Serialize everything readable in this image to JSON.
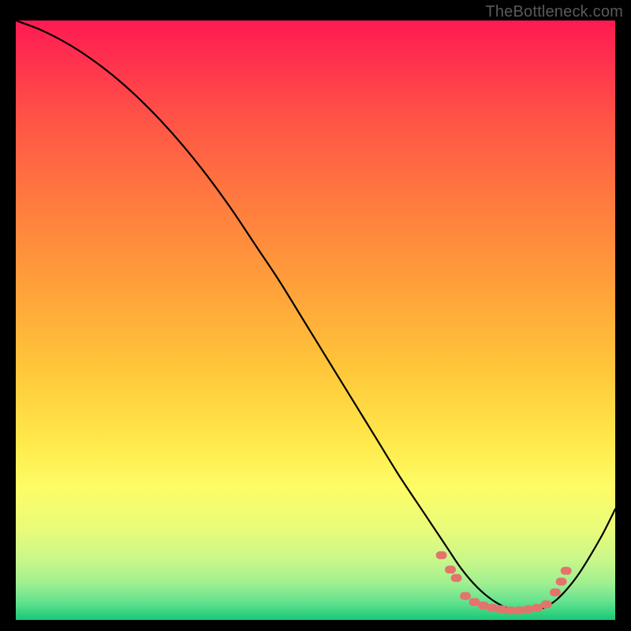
{
  "site": {
    "watermark": "TheBottleneck.com"
  },
  "chart_data": {
    "type": "line",
    "title": "",
    "xlabel": "",
    "ylabel": "",
    "xlim": [
      0,
      100
    ],
    "ylim": [
      0,
      100
    ],
    "background_gradient": {
      "stops": [
        {
          "offset": 0.0,
          "color": "#ff1a52"
        },
        {
          "offset": 0.05,
          "color": "#ff2b4f"
        },
        {
          "offset": 0.15,
          "color": "#ff4f47"
        },
        {
          "offset": 0.3,
          "color": "#ff7a3f"
        },
        {
          "offset": 0.45,
          "color": "#ffa23a"
        },
        {
          "offset": 0.58,
          "color": "#ffc63a"
        },
        {
          "offset": 0.7,
          "color": "#ffe84a"
        },
        {
          "offset": 0.78,
          "color": "#fdfd66"
        },
        {
          "offset": 0.85,
          "color": "#e8fb7a"
        },
        {
          "offset": 0.9,
          "color": "#c9f78a"
        },
        {
          "offset": 0.94,
          "color": "#9eef90"
        },
        {
          "offset": 0.97,
          "color": "#63e28f"
        },
        {
          "offset": 1.0,
          "color": "#17c877"
        }
      ]
    },
    "series": [
      {
        "name": "bottleneck-curve",
        "x": [
          0,
          4,
          8,
          12,
          16,
          20,
          24,
          28,
          32,
          36,
          40,
          44,
          48,
          52,
          56,
          60,
          64,
          68,
          70,
          72,
          74,
          76,
          78,
          80,
          82,
          84,
          86,
          88,
          90,
          92,
          94,
          96,
          98,
          100
        ],
        "y": [
          100,
          98.5,
          96.5,
          94,
          91,
          87.5,
          83.5,
          79,
          74,
          68.5,
          62.5,
          56.5,
          50,
          43.5,
          37,
          30.5,
          24,
          18,
          15,
          12,
          9,
          6.5,
          4.5,
          3,
          2,
          1.6,
          1.6,
          2,
          3.2,
          5.2,
          7.8,
          11,
          14.5,
          18.5
        ]
      }
    ],
    "markers": {
      "name": "highlight-band",
      "color": "#e2746c",
      "points": [
        {
          "x": 71,
          "y": 10.8
        },
        {
          "x": 72.5,
          "y": 8.4
        },
        {
          "x": 73.5,
          "y": 7.0
        },
        {
          "x": 75,
          "y": 4.0
        },
        {
          "x": 76.5,
          "y": 3.0
        },
        {
          "x": 78,
          "y": 2.4
        },
        {
          "x": 79.5,
          "y": 2.0
        },
        {
          "x": 81,
          "y": 1.8
        },
        {
          "x": 82.5,
          "y": 1.6
        },
        {
          "x": 84,
          "y": 1.6
        },
        {
          "x": 85.5,
          "y": 1.8
        },
        {
          "x": 87,
          "y": 2.0
        },
        {
          "x": 88.5,
          "y": 2.6
        },
        {
          "x": 90,
          "y": 4.6
        },
        {
          "x": 91,
          "y": 6.4
        },
        {
          "x": 91.8,
          "y": 8.2
        }
      ]
    }
  }
}
